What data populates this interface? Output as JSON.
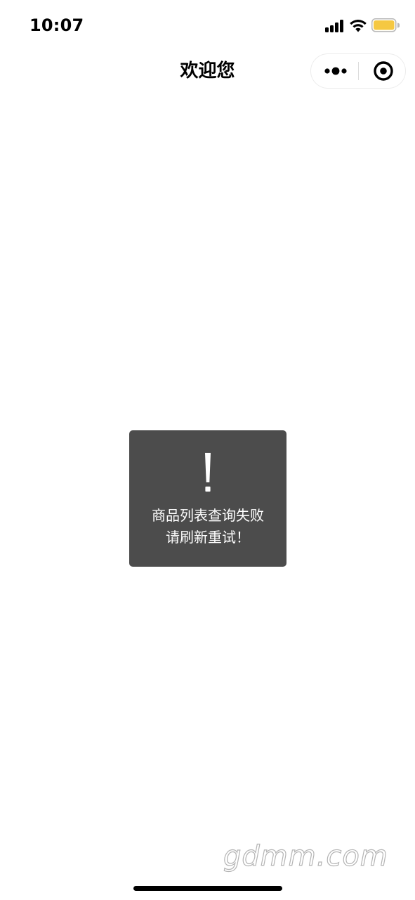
{
  "status_bar": {
    "time": "10:07",
    "icons": [
      "signal-icon",
      "wifi-icon",
      "battery-icon"
    ],
    "battery_color": "#f5c842"
  },
  "nav": {
    "title": "欢迎您",
    "capsule_icons": [
      "more-dots-icon",
      "close-target-icon"
    ]
  },
  "toast": {
    "icon": "exclamation-icon",
    "message": "商品列表查询失败\n请刷新重试！",
    "background": "#4c4c4c"
  },
  "watermark": {
    "text": "gdmm.com"
  }
}
